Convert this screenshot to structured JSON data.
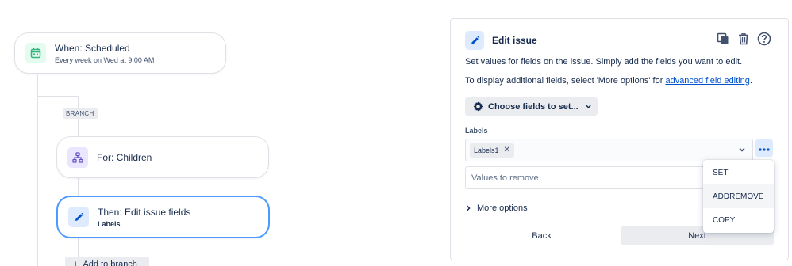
{
  "canvas": {
    "trigger": {
      "title": "When: Scheduled",
      "subtitle": "Every week on Wed at 9:00 AM",
      "icon": "calendar-icon",
      "color": "#36b37e"
    },
    "branch_tag": "BRANCH",
    "branch_node": {
      "title": "For: Children",
      "icon": "hierarchy-icon",
      "color": "#6554c0"
    },
    "action_node": {
      "title": "Then: Edit issue fields",
      "subtitle": "Labels",
      "icon": "pencil-icon",
      "selected": true,
      "color": "#0052cc"
    },
    "add_branch_label": "Add to branch"
  },
  "panel": {
    "title": "Edit issue",
    "icon": "pencil-icon",
    "toolbar": [
      "copy-icon",
      "trash-icon",
      "help-icon"
    ],
    "description_1": "Set values for fields on the issue. Simply add the fields you want to edit.",
    "description_2_prefix": "To display additional fields, select 'More options' for ",
    "description_2_link": "advanced field editing",
    "description_2_suffix": ".",
    "choose_fields_label": "Choose fields to set...",
    "field": {
      "label": "Labels",
      "chips": [
        "Labels1"
      ],
      "remove_placeholder": "Values to remove"
    },
    "more_options_label": "More options",
    "back_label": "Back",
    "next_label": "Next"
  },
  "menu": {
    "items": [
      "SET",
      "ADDREMOVE",
      "COPY"
    ],
    "selected": "ADDREMOVE"
  },
  "colors": {
    "accent": "#0052cc",
    "link": "#0052cc",
    "selected_border": "#4c9aff"
  }
}
